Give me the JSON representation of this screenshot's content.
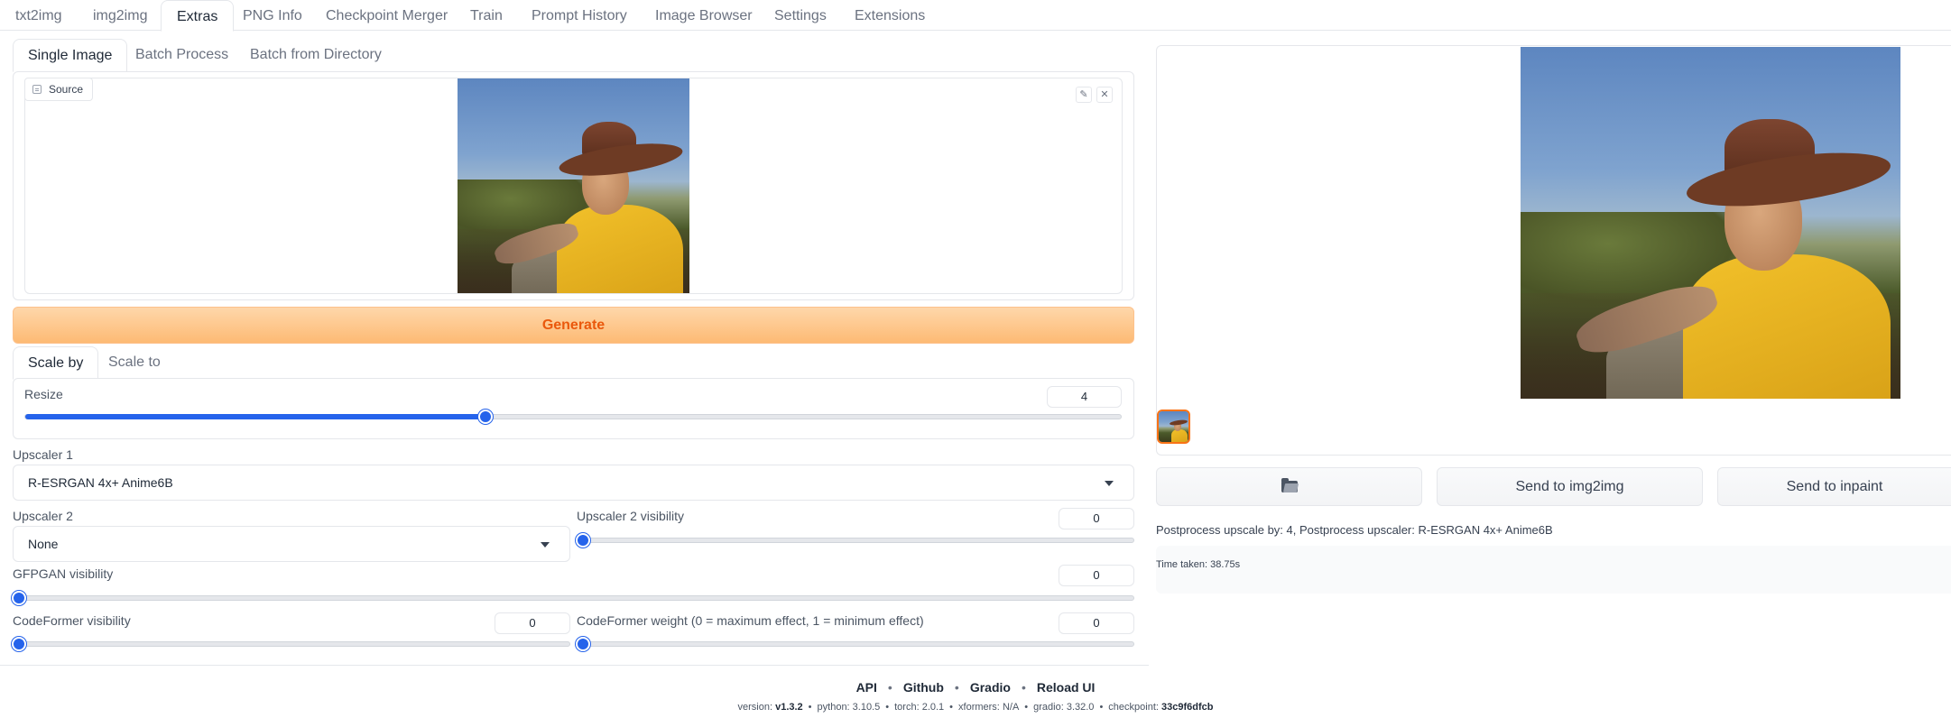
{
  "top_tabs": [
    "txt2img",
    "img2img",
    "Extras",
    "PNG Info",
    "Checkpoint Merger",
    "Train",
    "Prompt History",
    "Image Browser",
    "Settings",
    "Extensions"
  ],
  "active_top_tab": "Extras",
  "mode_tabs": [
    "Single Image",
    "Batch Process",
    "Batch from Directory"
  ],
  "active_mode_tab": "Single Image",
  "source": {
    "label": "Source",
    "edit_icon": "pencil-icon",
    "clear_icon": "close-icon"
  },
  "generate_label": "Generate",
  "scale_tabs": [
    "Scale by",
    "Scale to"
  ],
  "active_scale_tab": "Scale by",
  "resize": {
    "label": "Resize",
    "value": "4",
    "slider_fraction": 0.42
  },
  "upscaler1": {
    "label": "Upscaler 1",
    "value": "R-ESRGAN 4x+ Anime6B"
  },
  "upscaler2": {
    "label": "Upscaler 2",
    "value": "None"
  },
  "upscaler2_visibility": {
    "label": "Upscaler 2 visibility",
    "value": "0",
    "slider_fraction": 0
  },
  "gfpgan_visibility": {
    "label": "GFPGAN visibility",
    "value": "0",
    "slider_fraction": 0
  },
  "codeformer_visibility": {
    "label": "CodeFormer visibility",
    "value": "0",
    "slider_fraction": 0
  },
  "codeformer_weight": {
    "label": "CodeFormer weight (0 = maximum effect, 1 = minimum effect)",
    "value": "0",
    "slider_fraction": 0
  },
  "output": {
    "folder_icon": "folder-icon",
    "send_img2img": "Send to img2img",
    "send_inpaint": "Send to inpaint",
    "info_line": "Postprocess upscale by: 4, Postprocess upscaler: R-ESRGAN 4x+ Anime6B",
    "time_taken": "Time taken: 38.75s"
  },
  "footer": {
    "links": [
      "API",
      "Github",
      "Gradio",
      "Reload UI"
    ],
    "version_parts": [
      {
        "label": "version: ",
        "value": "v1.3.2"
      },
      {
        "label": "python: ",
        "value": "3.10.5"
      },
      {
        "label": "torch: ",
        "value": "2.0.1"
      },
      {
        "label": "xformers: ",
        "value": "N/A"
      },
      {
        "label": "gradio: ",
        "value": "3.32.0"
      },
      {
        "label": "checkpoint: ",
        "value": "33c9f6dfcb"
      }
    ]
  },
  "colors": {
    "accent": "#2563eb",
    "generate_text": "#ea580c",
    "generate_bg": "#fdba74",
    "selected_thumb": "#f97316"
  }
}
